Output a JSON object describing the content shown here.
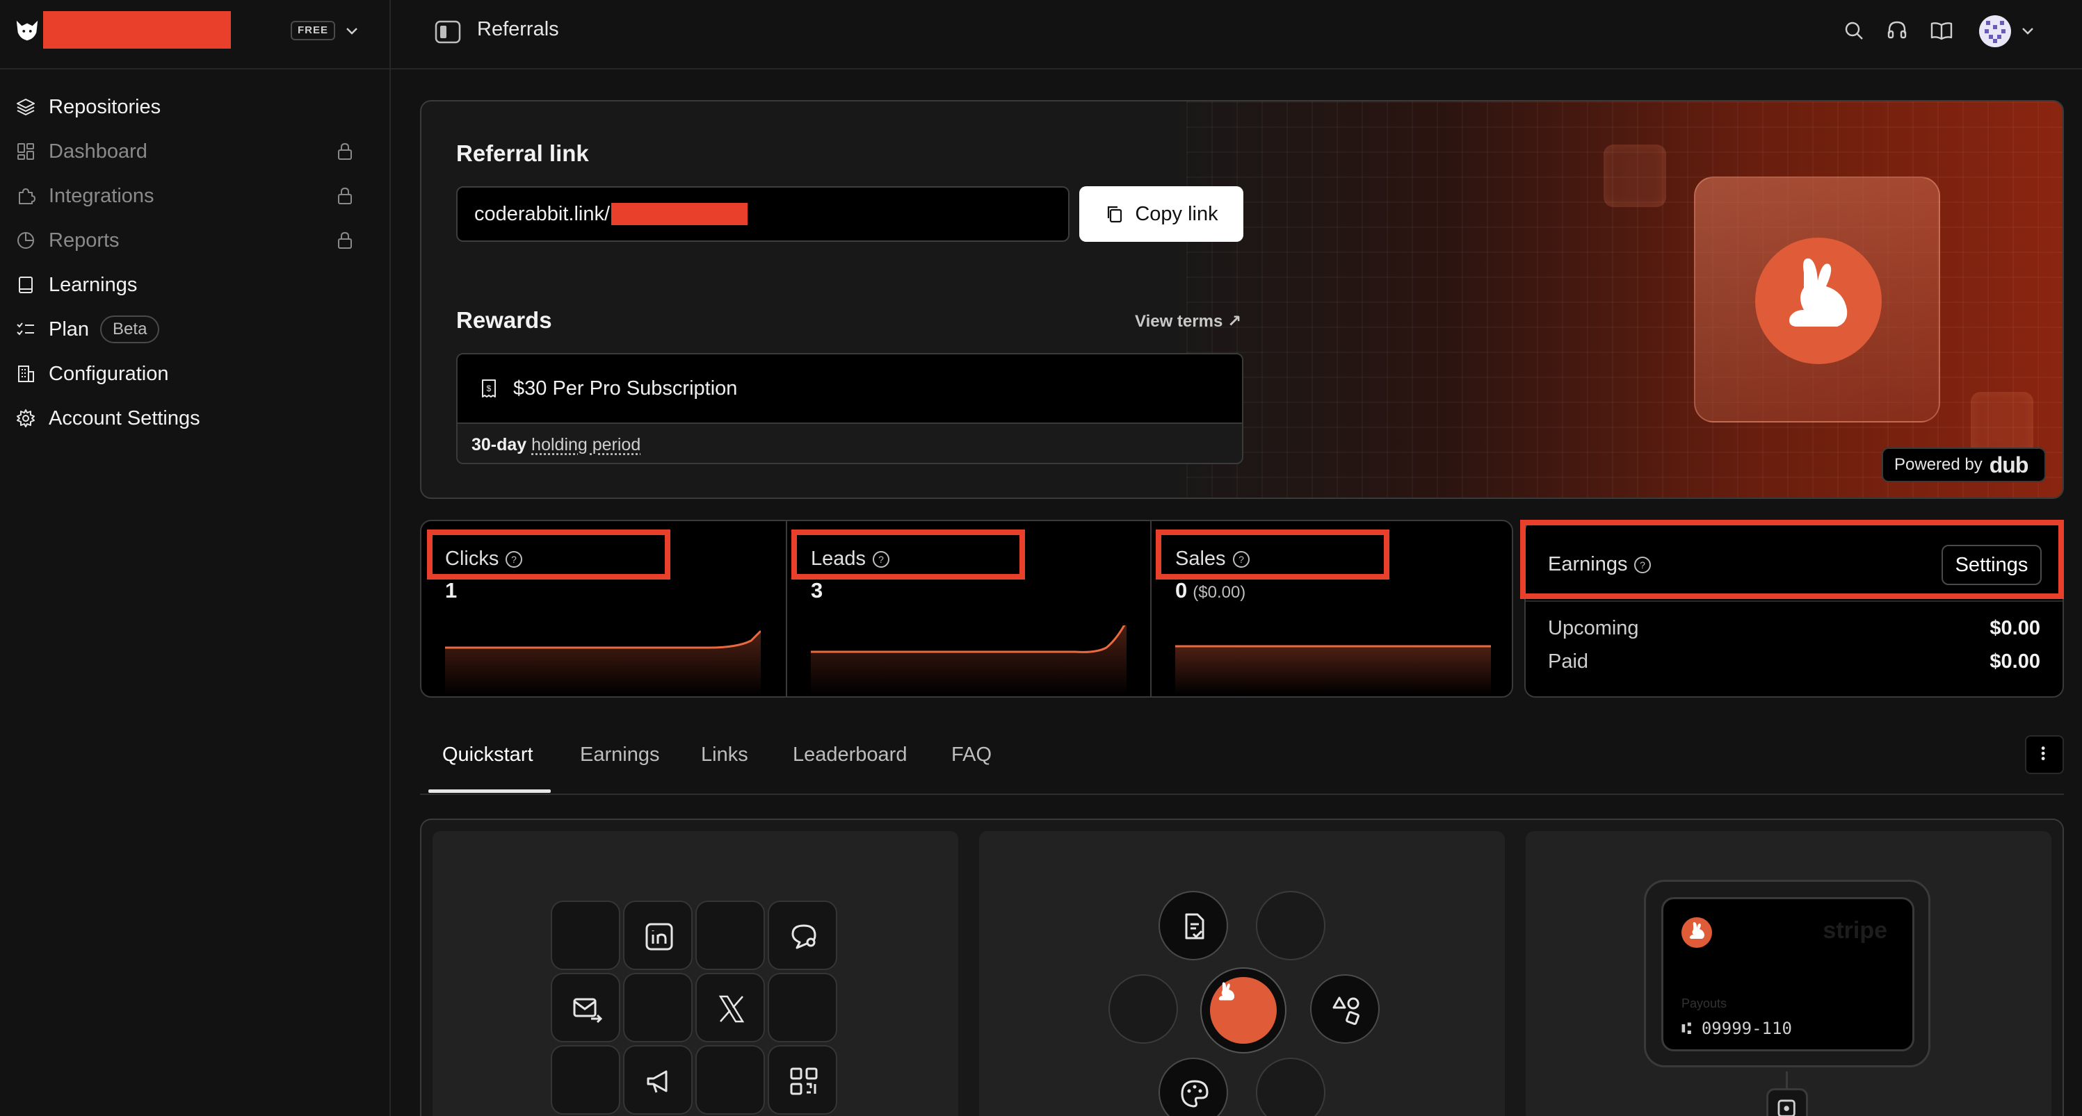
{
  "sidebar": {
    "plan_badge": "FREE",
    "items": [
      {
        "label": "Repositories",
        "icon": "layers-icon",
        "state": "active"
      },
      {
        "label": "Dashboard",
        "icon": "dashboard-icon",
        "state": "locked"
      },
      {
        "label": "Integrations",
        "icon": "puzzle-icon",
        "state": "locked"
      },
      {
        "label": "Reports",
        "icon": "pie-chart-icon",
        "state": "locked"
      },
      {
        "label": "Learnings",
        "icon": "book-icon",
        "state": "active"
      },
      {
        "label": "Plan",
        "icon": "checklist-icon",
        "state": "active",
        "badge": "Beta"
      },
      {
        "label": "Configuration",
        "icon": "building-icon",
        "state": "active"
      },
      {
        "label": "Account Settings",
        "icon": "gear-icon",
        "state": "active"
      }
    ]
  },
  "topbar": {
    "title": "Referrals",
    "icons": [
      "search-icon",
      "headset-icon",
      "book-open-icon"
    ]
  },
  "referral": {
    "link_title": "Referral link",
    "link_prefix": "coderabbit.link/",
    "copy_label": "Copy link",
    "rewards_title": "Rewards",
    "view_terms": "View terms ↗",
    "reward_text": "$30 Per Pro Subscription",
    "holding_bold": "30-day",
    "holding_text": "holding period",
    "powered_by": "Powered by",
    "powered_brand": "dub"
  },
  "stats": [
    {
      "label": "Clicks",
      "value": "1",
      "sub": ""
    },
    {
      "label": "Leads",
      "value": "3",
      "sub": ""
    },
    {
      "label": "Sales",
      "value": "0",
      "sub": "($0.00)"
    }
  ],
  "earnings": {
    "label": "Earnings",
    "settings_label": "Settings",
    "rows": [
      {
        "key": "Upcoming",
        "value": "$0.00"
      },
      {
        "key": "Paid",
        "value": "$0.00"
      }
    ]
  },
  "tabs": [
    "Quickstart",
    "Earnings",
    "Links",
    "Leaderboard",
    "FAQ"
  ],
  "quickstart": {
    "stripe_word": "stripe",
    "payouts_label": "Payouts",
    "payout_number": "09999-110"
  },
  "colors": {
    "accent": "#e05c38",
    "redaction": "#e8402a",
    "background": "#121212"
  }
}
